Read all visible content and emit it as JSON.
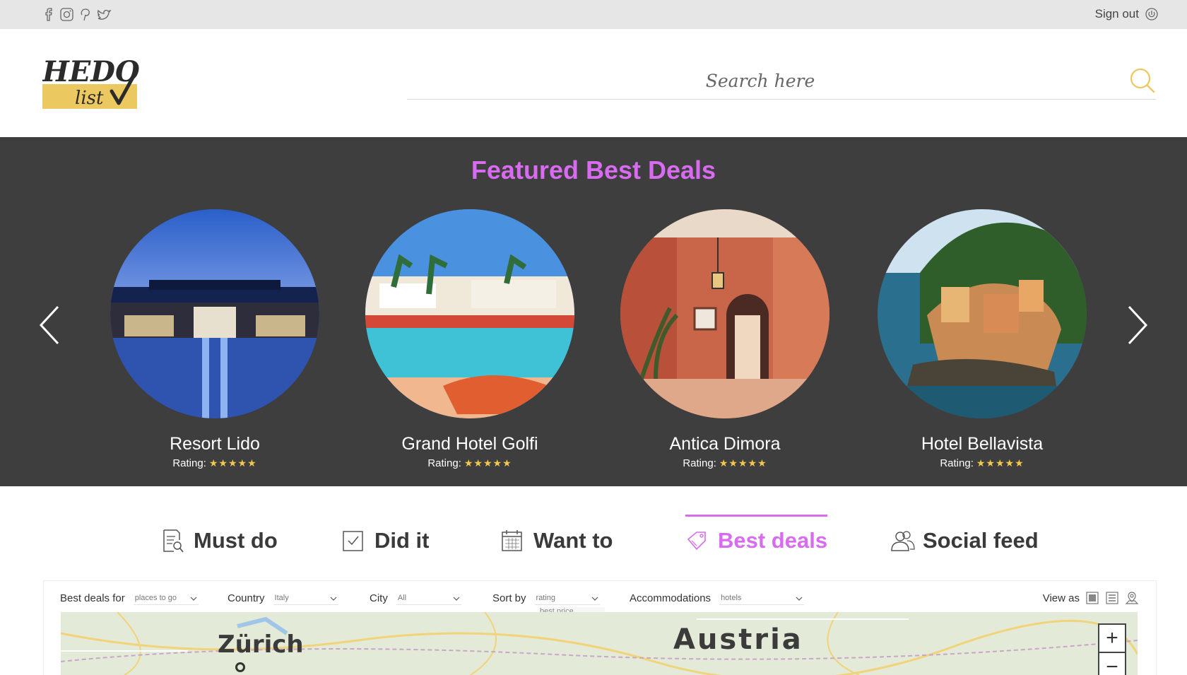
{
  "topbar": {
    "social_icons": [
      "facebook-icon",
      "instagram-icon",
      "pinterest-icon",
      "twitter-icon"
    ],
    "signout_label": "Sign out"
  },
  "header": {
    "logo_line1": "HEDO",
    "logo_line2": "list",
    "search_placeholder": "Search here"
  },
  "featured": {
    "title": "Featured Best Deals",
    "cards": [
      {
        "name": "Resort Lido",
        "rating_label": "Rating:",
        "stars": "★★★★★"
      },
      {
        "name": "Grand Hotel Golfi",
        "rating_label": "Rating:",
        "stars": "★★★★★"
      },
      {
        "name": "Antica Dimora",
        "rating_label": "Rating:",
        "stars": "★★★★★"
      },
      {
        "name": "Hotel Bellavista",
        "rating_label": "Rating:",
        "stars": "★★★★★"
      }
    ]
  },
  "tabs": [
    {
      "label": "Must do",
      "icon": "checklist-icon",
      "active": false
    },
    {
      "label": "Did it",
      "icon": "checkbox-icon",
      "active": false
    },
    {
      "label": "Want to",
      "icon": "calendar-icon",
      "active": false
    },
    {
      "label": "Best deals",
      "icon": "tag-icon",
      "active": true
    },
    {
      "label": "Social feed",
      "icon": "users-icon",
      "active": false
    }
  ],
  "filters": {
    "best_deals_for": {
      "label": "Best deals for",
      "value": "places to go"
    },
    "country": {
      "label": "Country",
      "value": "Italy"
    },
    "city": {
      "label": "City",
      "value": "All"
    },
    "sort_by": {
      "label": "Sort by",
      "value": "rating",
      "option_below": "best price"
    },
    "accommodations": {
      "label": "Accommodations",
      "value": "hotels"
    },
    "view_as": {
      "label": "View as",
      "icons": [
        "grid-view-icon",
        "list-view-icon",
        "map-view-icon"
      ]
    }
  },
  "map": {
    "labels": [
      "Zürich",
      "Austria"
    ],
    "zoom_in": "+",
    "zoom_out": "−"
  },
  "colors": {
    "accent": "#d86bf0",
    "star": "#f2c94c",
    "dark_band": "#3e3e3e",
    "logo_yellow": "#ecc860"
  }
}
